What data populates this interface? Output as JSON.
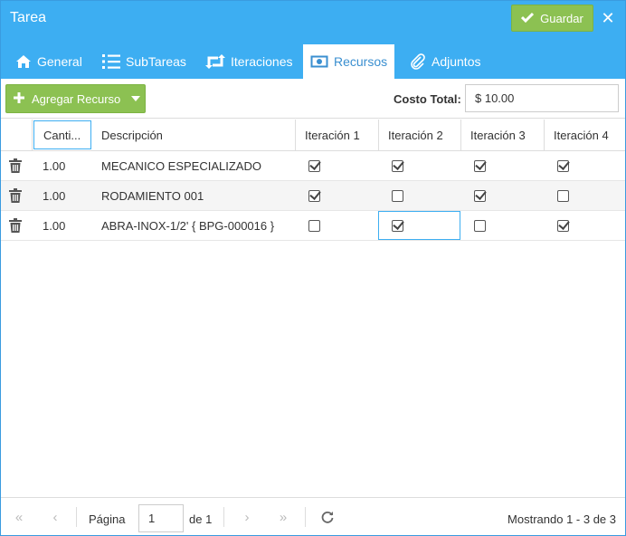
{
  "window": {
    "title": "Tarea",
    "save_label": "Guardar"
  },
  "tabs": [
    {
      "label": "General",
      "icon": "home-icon"
    },
    {
      "label": "SubTareas",
      "icon": "list-ordered-icon"
    },
    {
      "label": "Iteraciones",
      "icon": "retweet-icon"
    },
    {
      "label": "Recursos",
      "icon": "money-icon",
      "active": true
    },
    {
      "label": "Adjuntos",
      "icon": "paperclip-icon"
    }
  ],
  "toolbar": {
    "add_label": "Agregar Recurso",
    "cost_label": "Costo Total:",
    "cost_value": "$ 10.00"
  },
  "grid": {
    "columns": [
      "Canti...",
      "Descripción",
      "Iteración 1",
      "Iteración 2",
      "Iteración 3",
      "Iteración 4"
    ],
    "rows": [
      {
        "cantidad": "1.00",
        "descripcion": "MECANICO ESPECIALIZADO",
        "it": [
          true,
          true,
          true,
          true
        ]
      },
      {
        "cantidad": "1.00",
        "descripcion": "RODAMIENTO 001",
        "it": [
          true,
          false,
          true,
          false
        ]
      },
      {
        "cantidad": "1.00",
        "descripcion": "ABRA-INOX-1/2' { BPG-000016 }",
        "it": [
          false,
          true,
          false,
          true
        ]
      }
    ]
  },
  "pager": {
    "page_label": "Página",
    "page_value": "1",
    "of_label": "de 1",
    "info": "Mostrando 1 - 3 de 3"
  },
  "colors": {
    "header_blue": "#3daef2",
    "green": "#8cc152",
    "active_tab_text": "#3a8fd0"
  }
}
